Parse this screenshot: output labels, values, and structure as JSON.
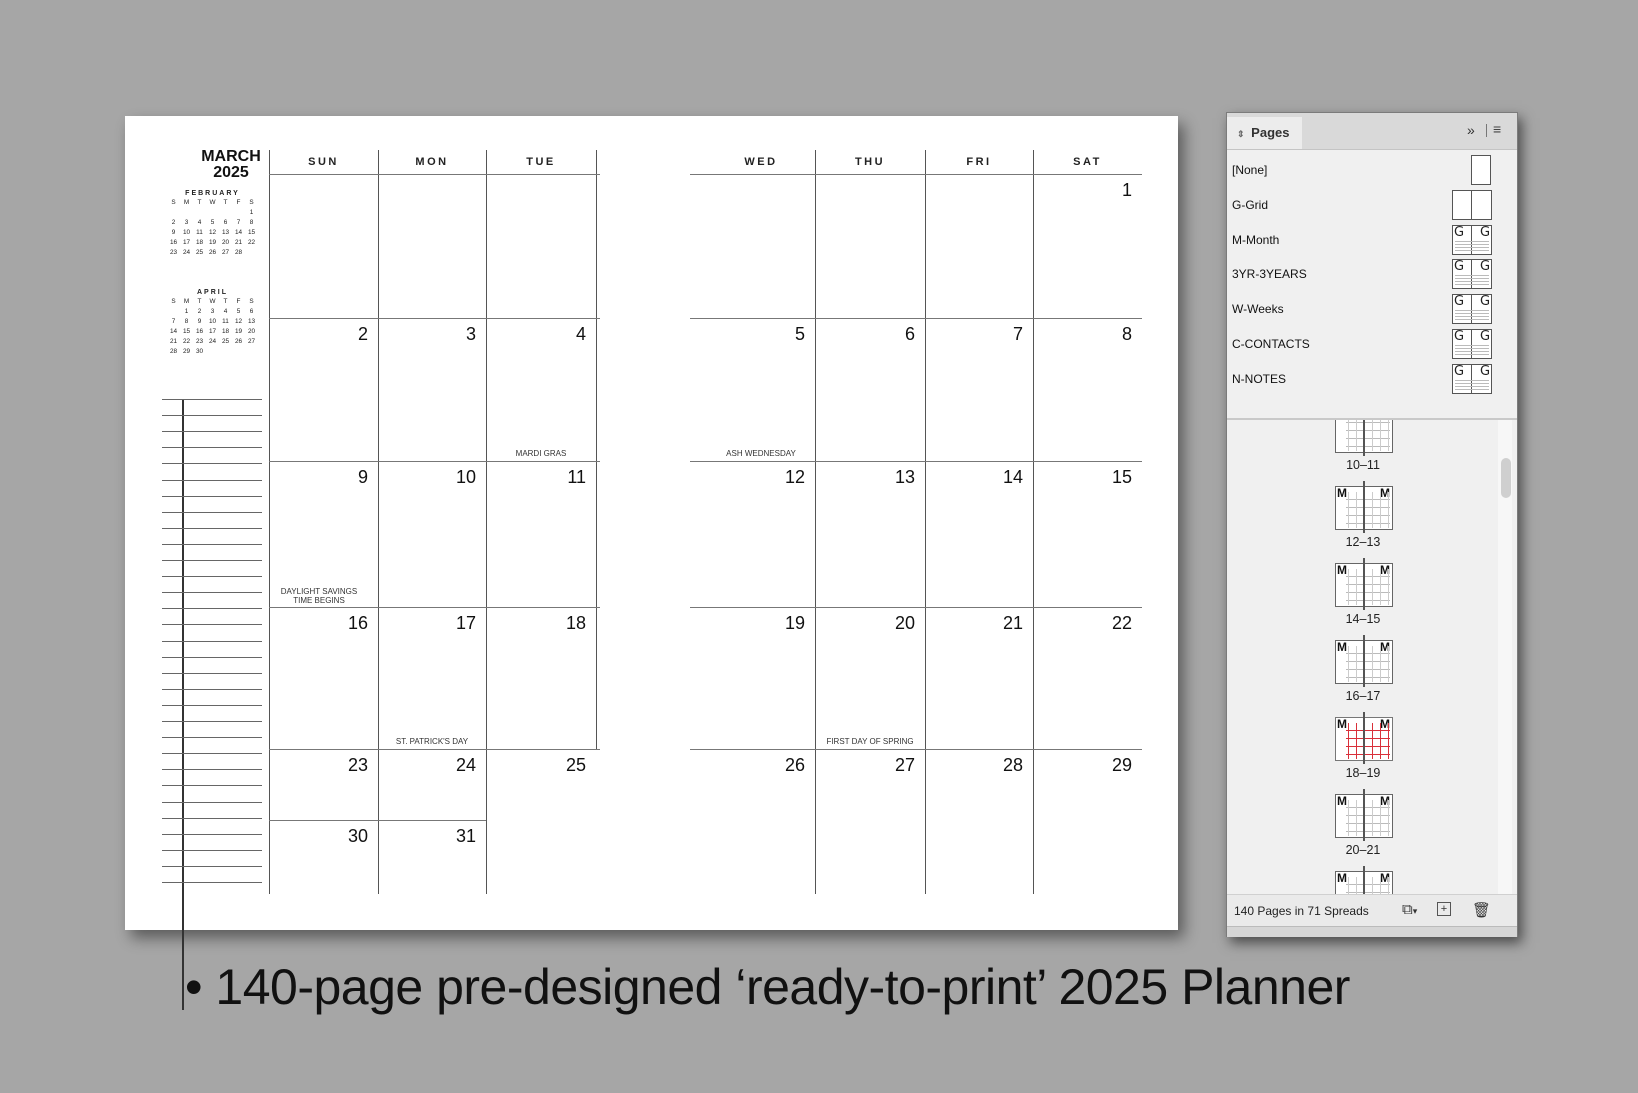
{
  "planner": {
    "month_title": "MARCH",
    "year": "2025",
    "mini_calendars": [
      {
        "name": "FEBRUARY",
        "weekdays": [
          "S",
          "M",
          "T",
          "W",
          "T",
          "F",
          "S"
        ],
        "weeks": [
          [
            "",
            "",
            "",
            "",
            "",
            "",
            "1"
          ],
          [
            "2",
            "3",
            "4",
            "5",
            "6",
            "7",
            "8"
          ],
          [
            "9",
            "10",
            "11",
            "12",
            "13",
            "14",
            "15"
          ],
          [
            "16",
            "17",
            "18",
            "19",
            "20",
            "21",
            "22"
          ],
          [
            "23",
            "24",
            "25",
            "26",
            "27",
            "28",
            ""
          ]
        ]
      },
      {
        "name": "APRIL",
        "weekdays": [
          "S",
          "M",
          "T",
          "W",
          "T",
          "F",
          "S"
        ],
        "weeks": [
          [
            "",
            "1",
            "2",
            "3",
            "4",
            "5",
            "6"
          ],
          [
            "7",
            "8",
            "9",
            "10",
            "11",
            "12",
            "13"
          ],
          [
            "14",
            "15",
            "16",
            "17",
            "18",
            "19",
            "20"
          ],
          [
            "21",
            "22",
            "23",
            "24",
            "25",
            "26",
            "27"
          ],
          [
            "28",
            "29",
            "30",
            "",
            "",
            "",
            ""
          ]
        ]
      }
    ],
    "weekday_headers": [
      "SUN",
      "MON",
      "TUE",
      "WED",
      "THU",
      "FRI",
      "SAT"
    ],
    "weeks": [
      [
        "",
        "",
        "",
        "",
        "",
        "",
        "1"
      ],
      [
        "2",
        "3",
        "4",
        "5",
        "6",
        "7",
        "8"
      ],
      [
        "9",
        "10",
        "11",
        "12",
        "13",
        "14",
        "15"
      ],
      [
        "16",
        "17",
        "18",
        "19",
        "20",
        "21",
        "22"
      ],
      [
        "23",
        "24",
        "25",
        "26",
        "27",
        "28",
        "29"
      ],
      [
        "30",
        "31",
        "",
        "",
        "",
        "",
        ""
      ]
    ],
    "events": [
      {
        "week": 1,
        "day": 2,
        "label": "MARDI GRAS"
      },
      {
        "week": 1,
        "day": 3,
        "label": "ASH WEDNESDAY"
      },
      {
        "week": 2,
        "day": 0,
        "label": "DAYLIGHT SAVINGS TIME BEGINS"
      },
      {
        "week": 3,
        "day": 1,
        "label": "ST. PATRICK'S DAY"
      },
      {
        "week": 3,
        "day": 4,
        "label": "FIRST DAY OF SPRING"
      }
    ]
  },
  "pages_panel": {
    "tab_label": "Pages",
    "tab_icon": "updown-arrows-icon",
    "collapse_icon": "double-chevron-right-icon",
    "menu_icon": "hamburger-menu-icon",
    "masters": [
      {
        "label": "[None]",
        "prefix": ""
      },
      {
        "label": "G-Grid",
        "prefix": ""
      },
      {
        "label": "M-Month",
        "prefix": "G"
      },
      {
        "label": "3YR-3YEARS",
        "prefix": "G"
      },
      {
        "label": "W-Weeks",
        "prefix": "G"
      },
      {
        "label": "C-CONTACTS",
        "prefix": "G"
      },
      {
        "label": "N-NOTES",
        "prefix": "G"
      }
    ],
    "spreads": [
      {
        "label": "10–11",
        "prefix": "M",
        "selected": false
      },
      {
        "label": "12–13",
        "prefix": "M",
        "selected": false
      },
      {
        "label": "14–15",
        "prefix": "M",
        "selected": false
      },
      {
        "label": "16–17",
        "prefix": "M",
        "selected": false
      },
      {
        "label": "18–19",
        "prefix": "M",
        "selected": true
      },
      {
        "label": "20–21",
        "prefix": "M",
        "selected": false
      },
      {
        "label": "",
        "prefix": "M",
        "selected": false
      }
    ],
    "footer_text": "140 Pages in 71 Spreads",
    "selection_color": "#d9303a"
  },
  "caption": "• 140-page pre-designed ‘ready-to-print’ 2025 Planner"
}
